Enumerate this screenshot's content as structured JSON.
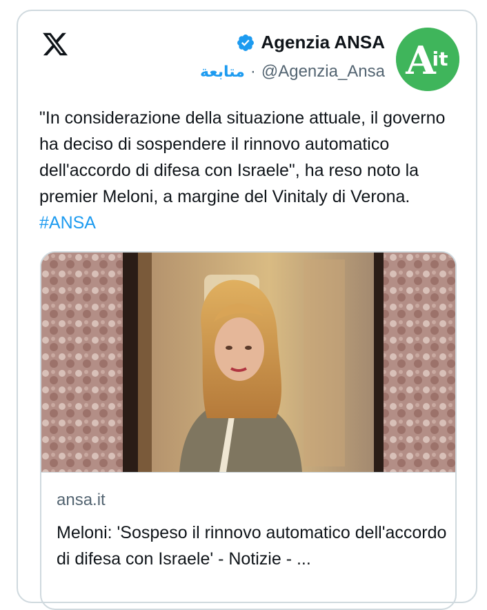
{
  "author": {
    "name": "Agenzia ANSA",
    "handle": "@Agenzia_Ansa",
    "separator": "·",
    "follow_label": "متابعة",
    "avatar_text": "Ait",
    "verified": true
  },
  "tweet": {
    "text": "\"In considerazione della situazione attuale, il governo ha deciso di sospendere il rinnovo automatico dell'accordo di difesa con Israele\", ha reso noto la premier Meloni, a margine del Vinitaly di Verona. ",
    "hashtag": "#ANSA"
  },
  "link_card": {
    "domain": "ansa.it",
    "title": "Meloni: 'Sospeso il rinnovo automatico dell'accordo di difesa con Israele' - Notizie - ..."
  },
  "colors": {
    "accent": "#1d9bf0",
    "text": "#0f1419",
    "secondary": "#536471",
    "border": "#cfd9de",
    "avatar": "#3fb55b"
  }
}
